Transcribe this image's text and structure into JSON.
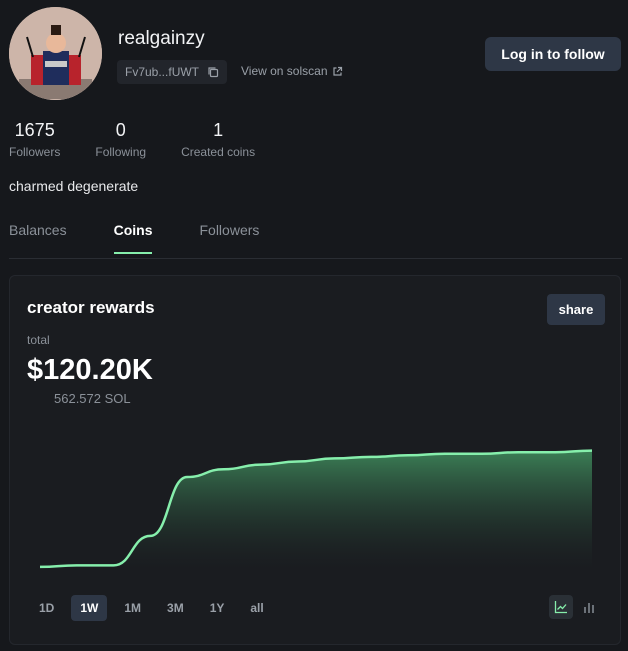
{
  "profile": {
    "username": "realgainzy",
    "address_short": "Fv7ub...fUWT",
    "solscan_label": "View on solscan",
    "follow_label": "Log in to follow",
    "bio": "charmed degenerate"
  },
  "stats": [
    {
      "value": "1675",
      "label": "Followers"
    },
    {
      "value": "0",
      "label": "Following"
    },
    {
      "value": "1",
      "label": "Created coins"
    }
  ],
  "tabs": [
    {
      "label": "Balances",
      "active": false
    },
    {
      "label": "Coins",
      "active": true
    },
    {
      "label": "Followers",
      "active": false
    }
  ],
  "rewards": {
    "title": "creator rewards",
    "share_label": "share",
    "total_label": "total",
    "total_value": "$120.20K",
    "total_sol": "562.572 SOL"
  },
  "time_ranges": [
    "1D",
    "1W",
    "1M",
    "3M",
    "1Y",
    "all"
  ],
  "active_range": "1W",
  "colors": {
    "accent": "#86efac",
    "button": "#2e3746",
    "background": "#16181c"
  },
  "chart_data": {
    "type": "area",
    "x": [
      0,
      1,
      2,
      3,
      4,
      5,
      6,
      7,
      8,
      9,
      10,
      11,
      12,
      13,
      14,
      15
    ],
    "values": [
      2,
      3,
      3,
      22,
      60,
      65,
      68,
      70,
      72,
      73,
      74,
      75,
      75,
      76,
      76,
      77
    ],
    "ylim": [
      0,
      80
    ],
    "grid": false
  }
}
